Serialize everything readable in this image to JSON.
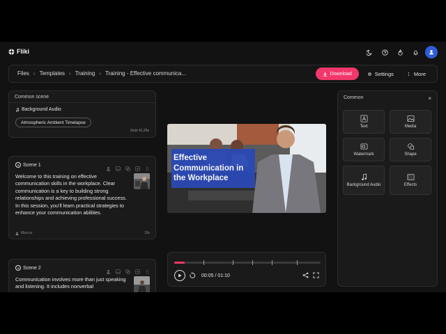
{
  "app": {
    "name": "Fliki"
  },
  "breadcrumb": {
    "items": [
      "Files",
      "Templates",
      "Training",
      "Training - Effective communica..."
    ]
  },
  "actions": {
    "download": "Download",
    "settings": "Settings",
    "more": "More"
  },
  "colors": {
    "accent": "#f2376b",
    "avatar": "#2f5fd8",
    "video_banner": "#2b49b5"
  },
  "common_scene": {
    "title": "Common scene",
    "audio_label": "Background Audio",
    "track": "Atmospheric Ambient Timelapse",
    "duration": "2min 41.25s"
  },
  "scenes": [
    {
      "label": "Scene 1",
      "text": "Welcome to this training on effective communication skills in the workplace. Clear communication is a key to building strong relationships and achieving professional success. In this session, you'll learn practical strategies to enhance your communication abilities.",
      "voice": "Marcus",
      "duration": "19s"
    },
    {
      "label": "Scene 2",
      "text": "Communication involves more than just speaking and listening. It includes nonverbal"
    }
  ],
  "video": {
    "title": "Effective Communication in the Workplace"
  },
  "player": {
    "timecode": "00:05 / 01:10",
    "progress": 0.07
  },
  "common_panel": {
    "title": "Common",
    "close": "×",
    "tiles": [
      "Text",
      "Media",
      "Watermark",
      "Shape",
      "Background Audio",
      "Effects"
    ]
  }
}
